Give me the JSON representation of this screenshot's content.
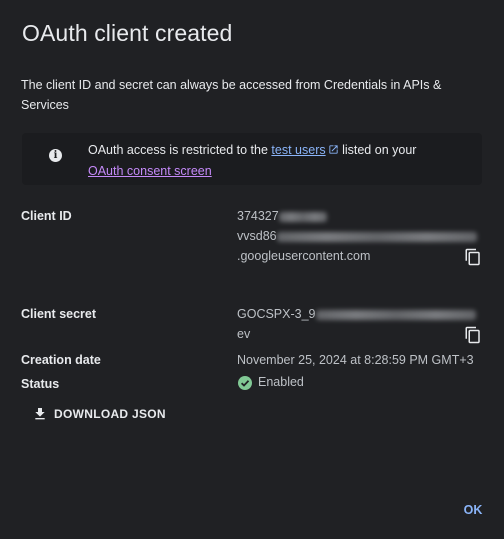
{
  "dialog": {
    "title": "OAuth client created",
    "description": "The client ID and secret can always be accessed from Credentials in APIs & Services"
  },
  "info": {
    "text_before": "OAuth access is restricted to the ",
    "test_users_link": "test users",
    "text_after": " listed on your",
    "consent_link": "OAuth consent screen",
    "icon": "info-icon"
  },
  "fields": {
    "client_id_label": "Client ID",
    "client_id_line1": "374327",
    "client_id_line2": "vvsd86",
    "client_id_line3": ".googleusercontent.com",
    "client_secret_label": "Client secret",
    "client_secret_line1": "GOCSPX-3_9",
    "client_secret_line2": "ev",
    "creation_date_label": "Creation date",
    "creation_date_value": "November 25, 2024 at 8:28:59 PM GMT+3",
    "status_label": "Status",
    "status_value": "Enabled"
  },
  "actions": {
    "download_label": "DOWNLOAD JSON",
    "ok_label": "OK"
  },
  "colors": {
    "background": "#202124",
    "link": "#8ab4f8",
    "visited_link": "#c58af9",
    "enabled": "#81c995"
  }
}
